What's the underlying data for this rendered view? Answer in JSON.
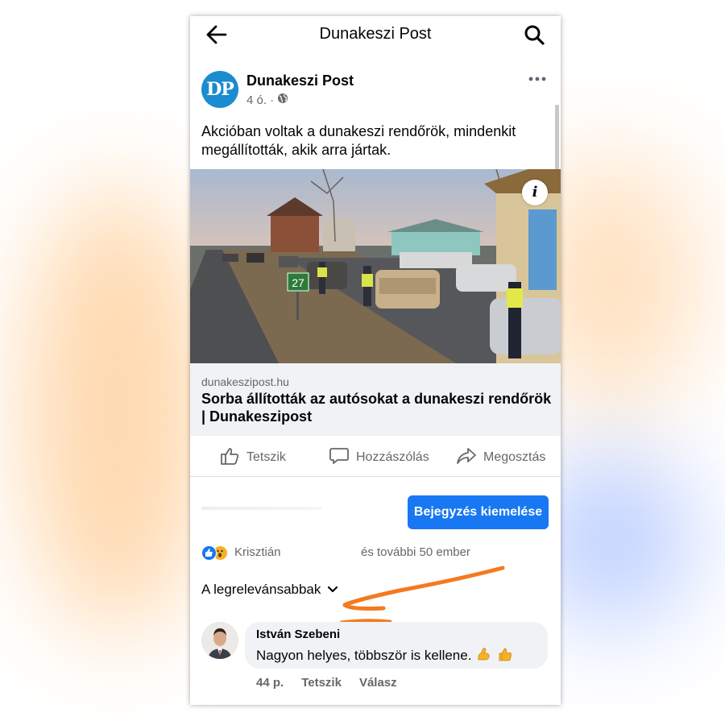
{
  "topbar": {
    "title": "Dunakeszi Post",
    "back_icon": "arrow-left-icon",
    "search_icon": "search-icon"
  },
  "post": {
    "page_avatar_text": "DP",
    "page_name": "Dunakeszi Post",
    "time": "4 ó. ·",
    "privacy_icon": "globe-icon",
    "more_icon": "more-icon",
    "text": "Akcióban voltak a dunakeszi rendőrök, mindenkit megállították, akik arra jártak.",
    "image_sign_number": "27",
    "info_label": "i",
    "link_domain": "dunakeszipost.hu",
    "link_title": "Sorba állították az autósokat a dunakeszi rendőrök | Dunakeszipost"
  },
  "actions": {
    "like": "Tetszik",
    "comment": "Hozzászólás",
    "share": "Megosztás"
  },
  "promote": {
    "label": "Bejegyzés kiemelése"
  },
  "reactions": {
    "name": "Krisztián",
    "others": "és további 50 ember"
  },
  "sort": {
    "label": "A legrelevánsabbak"
  },
  "comment": {
    "author": "István Szebeni",
    "text": "Nagyon helyes, többször is kellene.",
    "time": "44 p.",
    "like": "Tetszik",
    "reply": "Válasz"
  },
  "colors": {
    "accent": "#1877f2",
    "annotation": "#f47a20",
    "avatar_bg": "#1a8ccf"
  }
}
